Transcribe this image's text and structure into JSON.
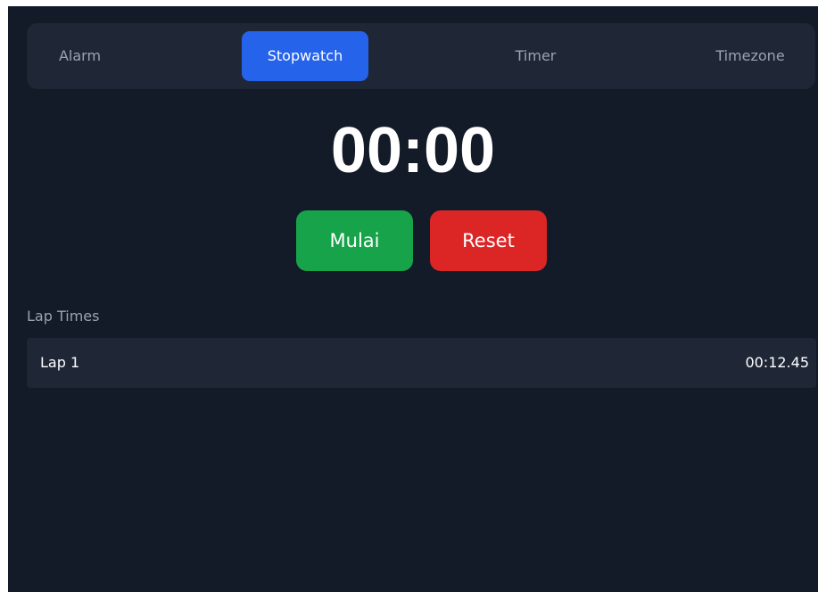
{
  "tabs": [
    {
      "label": "Alarm",
      "active": false
    },
    {
      "label": "Stopwatch",
      "active": true
    },
    {
      "label": "Timer",
      "active": false
    },
    {
      "label": "Timezone",
      "active": false
    }
  ],
  "stopwatch": {
    "display": "00:00",
    "start_label": "Mulai",
    "reset_label": "Reset"
  },
  "laps": {
    "title": "Lap Times",
    "items": [
      {
        "name": "Lap 1",
        "time": "00:12.45"
      }
    ]
  },
  "colors": {
    "background": "#131a28",
    "panel": "#1f2737",
    "accent": "#2563eb",
    "start": "#17a34a",
    "reset": "#dc2626"
  }
}
